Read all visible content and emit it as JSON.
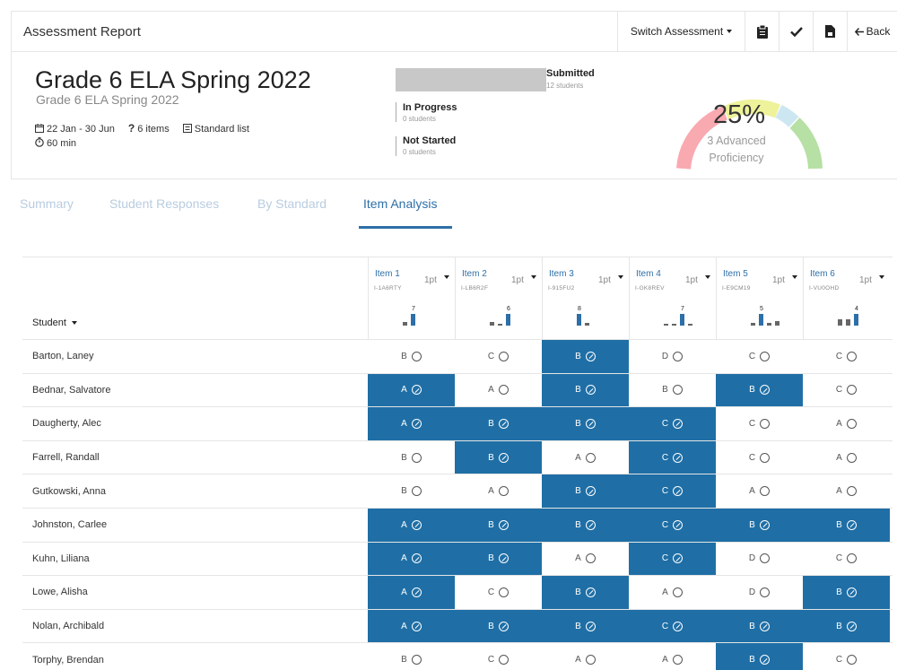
{
  "topbar": {
    "title": "Assessment Report",
    "switch_label": "Switch Assessment",
    "back_label": "Back",
    "icons": [
      "clipboard-icon",
      "check-icon",
      "file-icon",
      "back-arrow-icon"
    ]
  },
  "header": {
    "title": "Grade 6 ELA Spring 2022",
    "subtitle": "Grade 6 ELA Spring 2022",
    "dates": "22 Jan - 30 Jun",
    "items": "6 items",
    "standard_list": "Standard list",
    "duration": "60 min"
  },
  "status": {
    "submitted_label": "Submitted",
    "submitted_count": "12 students",
    "in_progress_label": "In Progress",
    "in_progress_count": "0 students",
    "not_started_label": "Not Started",
    "not_started_count": "0 students",
    "submitted_fraction": 1.0
  },
  "gauge": {
    "percent": "25%",
    "line1": "3 Advanced",
    "line2": "Proficiency",
    "colors": [
      "#f9a9b0",
      "#eef29a",
      "#cde7f2",
      "#b6e0a4"
    ]
  },
  "tabs": [
    {
      "label": "Summary",
      "active": false
    },
    {
      "label": "Student Responses",
      "active": false
    },
    {
      "label": "By Standard",
      "active": false
    },
    {
      "label": "Item Analysis",
      "active": true
    }
  ],
  "table": {
    "student_header": "Student",
    "items": [
      {
        "name": "Item 1",
        "code": "I-1A6RTY",
        "points": "1pt",
        "dist": [
          2,
          7,
          0,
          0
        ],
        "labels": [
          "",
          "7",
          "",
          ""
        ],
        "correct_index": 1
      },
      {
        "name": "Item 2",
        "code": "I-LB6R2F",
        "points": "1pt",
        "dist": [
          2,
          1,
          6,
          0
        ],
        "labels": [
          "",
          "",
          "6",
          ""
        ],
        "correct_index": 2
      },
      {
        "name": "Item 3",
        "code": "I-915FU2",
        "points": "1pt",
        "dist": [
          8,
          2,
          0,
          0
        ],
        "labels": [
          "8",
          "",
          "",
          ""
        ],
        "correct_index": 0
      },
      {
        "name": "Item 4",
        "code": "I-GK8REV",
        "points": "1pt",
        "dist": [
          1,
          1,
          7,
          1
        ],
        "labels": [
          "",
          "",
          "7",
          ""
        ],
        "correct_index": 2
      },
      {
        "name": "Item 5",
        "code": "I-E9CM19",
        "points": "1pt",
        "dist": [
          1,
          5,
          1,
          2
        ],
        "labels": [
          "",
          "5",
          "",
          ""
        ],
        "correct_index": 1
      },
      {
        "name": "Item 6",
        "code": "I-VU0OHD",
        "points": "1pt",
        "dist": [
          2,
          2,
          4,
          0
        ],
        "labels": [
          "",
          "",
          "4",
          ""
        ],
        "correct_index": 2
      }
    ],
    "rows": [
      {
        "student": "Barton, Laney",
        "answers": [
          "B",
          "C",
          "B",
          "D",
          "C",
          "C"
        ],
        "correct": [
          false,
          false,
          true,
          false,
          false,
          false
        ]
      },
      {
        "student": "Bednar, Salvatore",
        "answers": [
          "A",
          "A",
          "B",
          "B",
          "B",
          "C"
        ],
        "correct": [
          true,
          false,
          true,
          false,
          true,
          false
        ]
      },
      {
        "student": "Daugherty, Alec",
        "answers": [
          "A",
          "B",
          "B",
          "C",
          "C",
          "A"
        ],
        "correct": [
          true,
          true,
          true,
          true,
          false,
          false
        ]
      },
      {
        "student": "Farrell, Randall",
        "answers": [
          "B",
          "B",
          "A",
          "C",
          "C",
          "A"
        ],
        "correct": [
          false,
          true,
          false,
          true,
          false,
          false
        ]
      },
      {
        "student": "Gutkowski, Anna",
        "answers": [
          "B",
          "A",
          "B",
          "C",
          "A",
          "A"
        ],
        "correct": [
          false,
          false,
          true,
          true,
          false,
          false
        ]
      },
      {
        "student": "Johnston, Carlee",
        "answers": [
          "A",
          "B",
          "B",
          "C",
          "B",
          "B"
        ],
        "correct": [
          true,
          true,
          true,
          true,
          true,
          true
        ]
      },
      {
        "student": "Kuhn, Liliana",
        "answers": [
          "A",
          "B",
          "A",
          "C",
          "D",
          "C"
        ],
        "correct": [
          true,
          true,
          false,
          true,
          false,
          false
        ]
      },
      {
        "student": "Lowe, Alisha",
        "answers": [
          "A",
          "C",
          "B",
          "A",
          "D",
          "B"
        ],
        "correct": [
          true,
          false,
          true,
          false,
          false,
          true
        ]
      },
      {
        "student": "Nolan, Archibald",
        "answers": [
          "A",
          "B",
          "B",
          "C",
          "B",
          "B"
        ],
        "correct": [
          true,
          true,
          true,
          true,
          true,
          true
        ]
      },
      {
        "student": "Torphy, Brendan",
        "answers": [
          "B",
          "C",
          "A",
          "A",
          "B",
          "C"
        ],
        "correct": [
          false,
          false,
          false,
          false,
          true,
          false
        ]
      }
    ]
  }
}
